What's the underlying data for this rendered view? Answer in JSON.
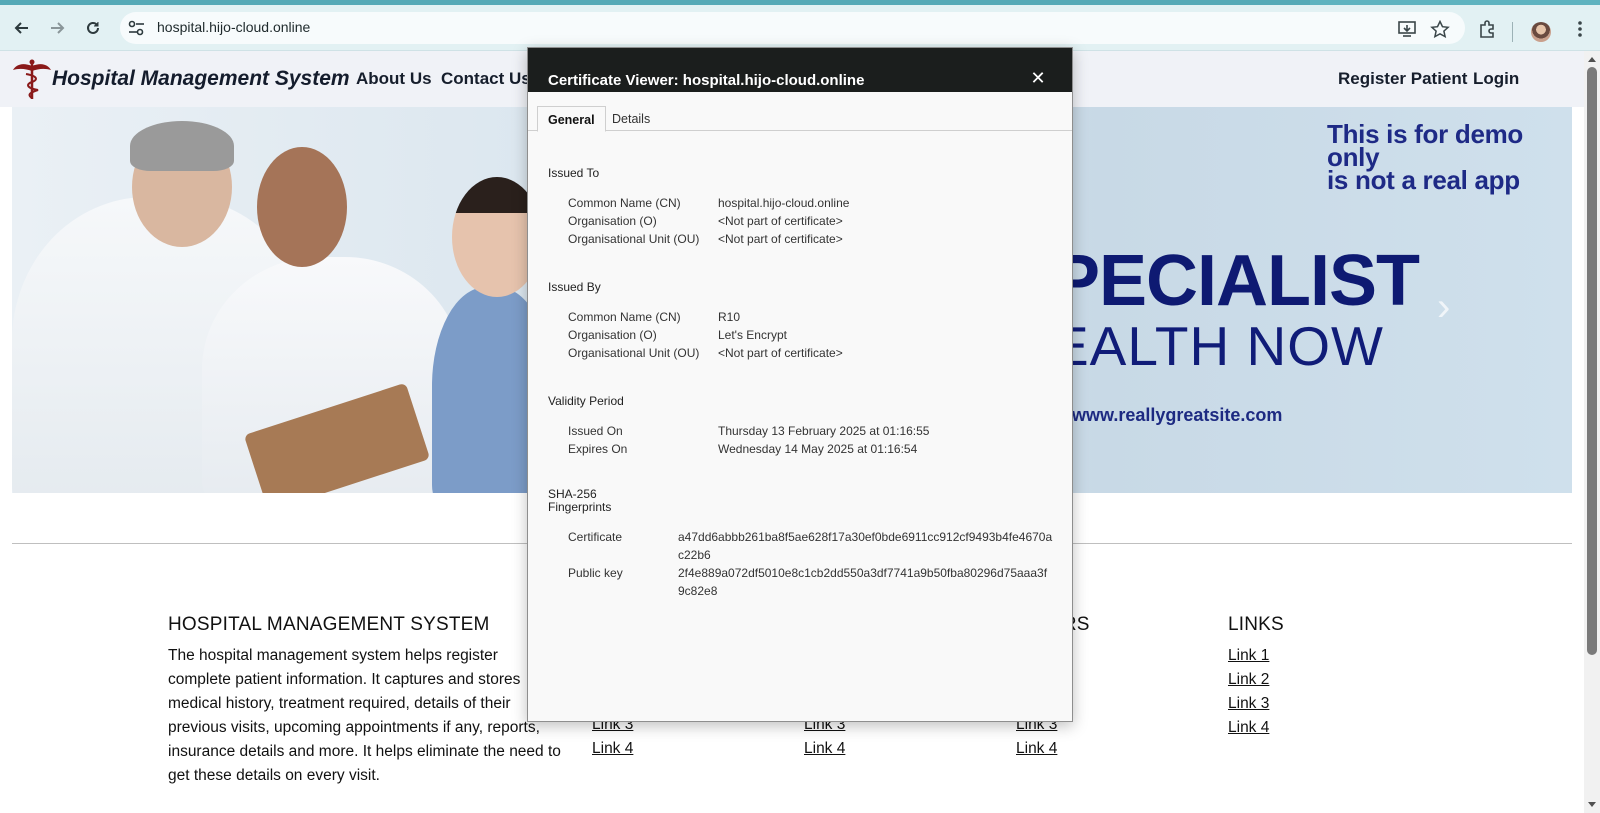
{
  "browser": {
    "url": "hospital.hijo-cloud.online",
    "icons": {
      "back": "back-arrow-icon",
      "forward": "forward-arrow-icon",
      "reload": "reload-icon",
      "site_info": "site-info-icon",
      "install": "install-app-icon",
      "bookmark": "star-icon",
      "extensions": "puzzle-icon",
      "menu": "kebab-menu-icon"
    }
  },
  "navbar": {
    "brand": "Hospital Management System",
    "links": [
      "About Us",
      "Contact Us"
    ],
    "right_links": [
      "Register Patient",
      "Login"
    ]
  },
  "hero": {
    "demo_line1": "This is for demo",
    "demo_line2": "only",
    "demo_line3": "is not a real app",
    "big_line1": "PECIALIST",
    "big_line2": "EALTH NOW",
    "site": "www.reallygreatsite.com"
  },
  "footer": {
    "about_title": "HOSPITAL MANAGEMENT SYSTEM",
    "about_text": "The hospital management system helps register complete patient information. It captures and stores medical history, treatment required, details of their previous visits, upcoming appointments if any, reports, insurance details and more. It helps eliminate the need to get these details on every visit.",
    "col3_title_fragment": "ERS",
    "links_title": "LINKS",
    "col2_links": [
      "Link 3",
      "Link 4"
    ],
    "col3_links": [
      "Link 3",
      "Link 4"
    ],
    "col4_partial_links": [
      "Link 3",
      "Link 4"
    ],
    "links": [
      "Link 1",
      "Link 2",
      "Link 3",
      "Link 4"
    ]
  },
  "certificate": {
    "title": "Certificate Viewer: hospital.hijo-cloud.online",
    "tabs": [
      "General",
      "Details"
    ],
    "issued_to": {
      "heading": "Issued To",
      "rows": [
        {
          "label": "Common Name (CN)",
          "value": "hospital.hijo-cloud.online"
        },
        {
          "label": "Organisation (O)",
          "value": "<Not part of certificate>"
        },
        {
          "label": "Organisational Unit (OU)",
          "value": "<Not part of certificate>"
        }
      ]
    },
    "issued_by": {
      "heading": "Issued By",
      "rows": [
        {
          "label": "Common Name (CN)",
          "value": "R10"
        },
        {
          "label": "Organisation (O)",
          "value": "Let's Encrypt"
        },
        {
          "label": "Organisational Unit (OU)",
          "value": "<Not part of certificate>"
        }
      ]
    },
    "validity": {
      "heading": "Validity Period",
      "rows": [
        {
          "label": "Issued On",
          "value": "Thursday 13 February 2025 at 01:16:55"
        },
        {
          "label": "Expires On",
          "value": "Wednesday 14 May 2025 at 01:16:54"
        }
      ]
    },
    "fingerprints": {
      "heading_line1": "SHA-256",
      "heading_line2": "Fingerprints",
      "rows": [
        {
          "label": "Certificate",
          "value": "a47dd6abbb261ba8f5ae628f17a30ef0bde6911cc912cf9493b4fe4670ac22b6"
        },
        {
          "label": "Public key",
          "value": "2f4e889a072df5010e8c1cb2dd550a3df7741a9b50fba80296d75aaa3f9c82e8"
        }
      ]
    }
  }
}
